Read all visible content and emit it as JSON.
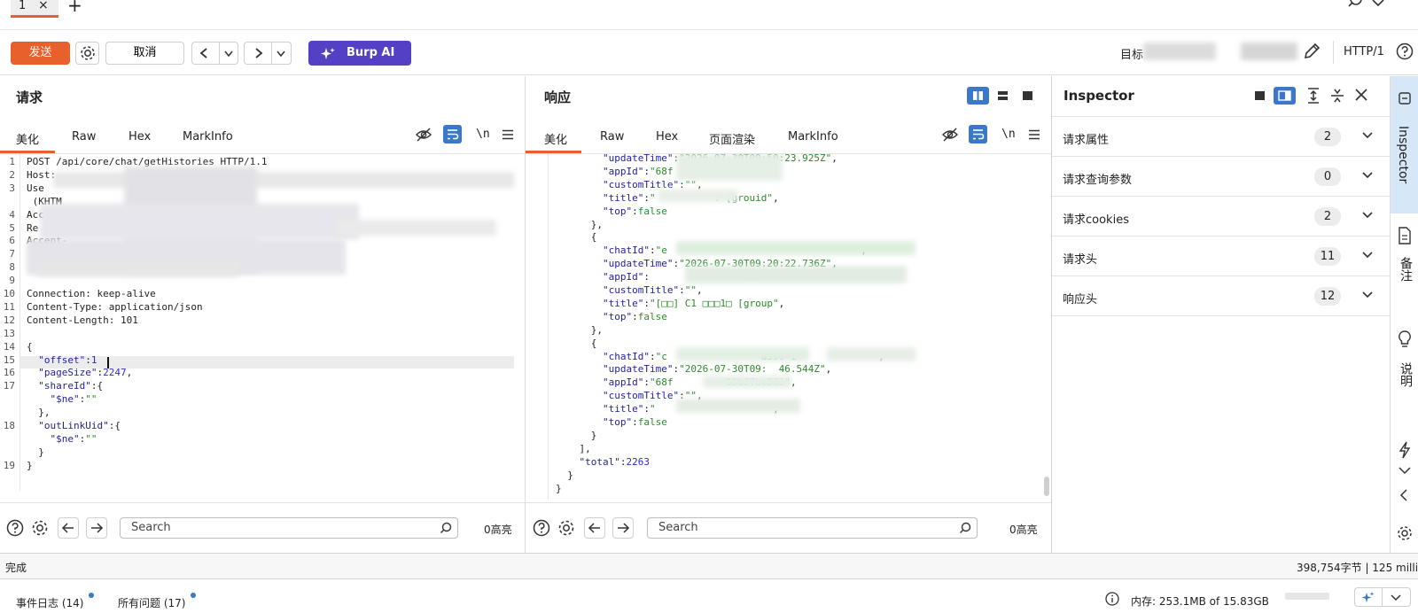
{
  "tabs": {
    "active_label": "1",
    "close_glyph": "×",
    "add_glyph": "+"
  },
  "toolbar": {
    "send": "发送",
    "cancel": "取消",
    "burp_ai": "Burp AI",
    "target_label": "目标",
    "http_version": "HTTP/1"
  },
  "request": {
    "title": "请求",
    "tabs": [
      "美化",
      "Raw",
      "Hex",
      "MarkInfo"
    ],
    "newline_toggle": "\\n",
    "lines": [
      {
        "n": "1",
        "parts": [
          [
            "t",
            "POST /api/core/chat/getHistories HTTP/1.1"
          ]
        ]
      },
      {
        "n": "2",
        "parts": [
          [
            "t",
            "Host: "
          ]
        ]
      },
      {
        "n": "3",
        "parts": [
          [
            "t",
            "Use"
          ]
        ]
      },
      {
        "n": "",
        "parts": [
          [
            "t",
            " (KHTM"
          ]
        ]
      },
      {
        "n": "4",
        "parts": [
          [
            "t",
            "Accept: appl"
          ]
        ]
      },
      {
        "n": "5",
        "parts": [
          [
            "t",
            "Re"
          ]
        ]
      },
      {
        "n": "6",
        "parts": [
          [
            "t",
            "Accept-"
          ]
        ]
      },
      {
        "n": "7",
        "parts": [
          [
            "t",
            ""
          ]
        ]
      },
      {
        "n": "8",
        "parts": [
          [
            "t",
            ""
          ]
        ]
      },
      {
        "n": "9",
        "parts": [
          [
            "t",
            ""
          ]
        ]
      },
      {
        "n": "10",
        "parts": [
          [
            "t",
            "Connection: keep-alive"
          ]
        ]
      },
      {
        "n": "11",
        "parts": [
          [
            "t",
            "Content-Type: application/json"
          ]
        ]
      },
      {
        "n": "12",
        "parts": [
          [
            "t",
            "Content-Length: 101"
          ]
        ]
      },
      {
        "n": "13",
        "parts": [
          [
            "t",
            ""
          ]
        ]
      },
      {
        "n": "14",
        "parts": [
          [
            "t",
            "{"
          ]
        ]
      },
      {
        "n": "15",
        "parts": [
          [
            "t",
            "  "
          ],
          [
            "k",
            "\"offset\""
          ],
          [
            "t",
            ":"
          ],
          [
            "n",
            "1"
          ]
        ]
      },
      {
        "n": "16",
        "parts": [
          [
            "t",
            "  "
          ],
          [
            "k",
            "\"pageSize\""
          ],
          [
            "t",
            ":"
          ],
          [
            "n",
            "2247"
          ],
          [
            "t",
            ","
          ]
        ]
      },
      {
        "n": "17",
        "parts": [
          [
            "t",
            "  "
          ],
          [
            "k",
            "\"shareId\""
          ],
          [
            "t",
            ":{"
          ]
        ]
      },
      {
        "n": "",
        "parts": [
          [
            "t",
            "    "
          ],
          [
            "k",
            "\"$ne\""
          ],
          [
            "t",
            ":"
          ],
          [
            "s",
            "\"\""
          ]
        ]
      },
      {
        "n": "",
        "parts": [
          [
            "t",
            "  },"
          ]
        ]
      },
      {
        "n": "18",
        "parts": [
          [
            "t",
            "  "
          ],
          [
            "k",
            "\"outLinkUid\""
          ],
          [
            "t",
            ":{"
          ]
        ]
      },
      {
        "n": "",
        "parts": [
          [
            "t",
            "    "
          ],
          [
            "k",
            "\"$ne\""
          ],
          [
            "t",
            ":"
          ],
          [
            "s",
            "\"\""
          ]
        ]
      },
      {
        "n": "",
        "parts": [
          [
            "t",
            "  }"
          ]
        ]
      },
      {
        "n": "19",
        "parts": [
          [
            "t",
            "}"
          ]
        ]
      }
    ],
    "search_placeholder": "Search",
    "highlights": "0高亮"
  },
  "response": {
    "title": "响应",
    "tabs": [
      "美化",
      "Raw",
      "Hex",
      "页面渲染",
      "MarkInfo"
    ],
    "newline_toggle": "\\n",
    "lines": [
      {
        "parts": [
          [
            "t",
            "        "
          ],
          [
            "k",
            "\"updateTime\""
          ],
          [
            "t",
            ":"
          ],
          [
            "s",
            "\"2026-07-30T09:50:23.925Z\""
          ],
          [
            "t",
            ","
          ]
        ]
      },
      {
        "parts": [
          [
            "t",
            "        "
          ],
          [
            "k",
            "\"appId\""
          ],
          [
            "t",
            ":"
          ],
          [
            "s",
            "\"68f"
          ],
          [
            "t",
            "          "
          ],
          [
            "s",
            "363\""
          ],
          [
            "t",
            ","
          ]
        ]
      },
      {
        "parts": [
          [
            "t",
            "        "
          ],
          [
            "k",
            "\"customTitle\""
          ],
          [
            "t",
            ":"
          ],
          [
            "s",
            "\"\""
          ],
          [
            "t",
            ","
          ]
        ]
      },
      {
        "parts": [
          [
            "t",
            "        "
          ],
          [
            "k",
            "\"title\""
          ],
          [
            "t",
            ":"
          ],
          [
            "s",
            "\"          ! [grou"
          ],
          [
            "s",
            "id\""
          ],
          [
            "t",
            ","
          ]
        ]
      },
      {
        "parts": [
          [
            "t",
            "        "
          ],
          [
            "k",
            "\"top\""
          ],
          [
            "t",
            ":"
          ],
          [
            "s",
            "false"
          ]
        ]
      },
      {
        "parts": [
          [
            "t",
            "      },"
          ]
        ]
      },
      {
        "parts": [
          [
            "t",
            "      {"
          ]
        ]
      },
      {
        "parts": [
          [
            "t",
            "        "
          ],
          [
            "k",
            "\"chatId\""
          ],
          [
            "t",
            ":"
          ],
          [
            "s",
            "\"e"
          ],
          [
            "t",
            "                                 "
          ],
          [
            "t",
            ","
          ]
        ]
      },
      {
        "parts": [
          [
            "t",
            "        "
          ],
          [
            "k",
            "\"updateTime\""
          ],
          [
            "t",
            ":"
          ],
          [
            "s",
            "\"2026-07-30T09:20:22.736Z\""
          ],
          [
            "t",
            ","
          ]
        ]
      },
      {
        "parts": [
          [
            "t",
            "        "
          ],
          [
            "k",
            "\"appId\""
          ],
          [
            "t",
            ":"
          ],
          [
            "t",
            "                "
          ],
          [
            "s",
            "7b"
          ]
        ]
      },
      {
        "parts": [
          [
            "t",
            "        "
          ],
          [
            "k",
            "\"customTitle\""
          ],
          [
            "t",
            ":"
          ],
          [
            "s",
            "\"\""
          ],
          [
            "t",
            ","
          ]
        ]
      },
      {
        "parts": [
          [
            "t",
            "        "
          ],
          [
            "k",
            "\"title\""
          ],
          [
            "t",
            ":"
          ],
          [
            "s",
            "\"[□□] C1 □□□1□ [group\""
          ],
          [
            "t",
            ","
          ]
        ]
      },
      {
        "parts": [
          [
            "t",
            "        "
          ],
          [
            "k",
            "\"top\""
          ],
          [
            "t",
            ":"
          ],
          [
            "s",
            "false"
          ]
        ]
      },
      {
        "parts": [
          [
            "t",
            "      },"
          ]
        ]
      },
      {
        "parts": [
          [
            "t",
            "      {"
          ]
        ]
      },
      {
        "parts": [
          [
            "t",
            "        "
          ],
          [
            "k",
            "\"chatId\""
          ],
          [
            "t",
            ":"
          ],
          [
            "s",
            "\"c"
          ],
          [
            "t",
            "               "
          ],
          [
            "s",
            "-a990-1"
          ],
          [
            "t",
            "             "
          ],
          [
            "t",
            "',"
          ]
        ]
      },
      {
        "parts": [
          [
            "t",
            "        "
          ],
          [
            "k",
            "\"updateTime\""
          ],
          [
            "t",
            ":"
          ],
          [
            "s",
            "\"2026-07-30T09:"
          ],
          [
            "t",
            "  "
          ],
          [
            "s",
            "46.544Z\""
          ],
          [
            "t",
            ","
          ]
        ]
      },
      {
        "parts": [
          [
            "t",
            "        "
          ],
          [
            "k",
            "\"appId\""
          ],
          [
            "t",
            ":"
          ],
          [
            "s",
            "\"68f"
          ],
          [
            "t",
            "         "
          ],
          [
            "s",
            "88b37bc363\""
          ],
          [
            "t",
            ","
          ]
        ]
      },
      {
        "parts": [
          [
            "t",
            "        "
          ],
          [
            "k",
            "\"customTitle\""
          ],
          [
            "t",
            ":"
          ],
          [
            "s",
            "\"\""
          ],
          [
            "t",
            ","
          ]
        ]
      },
      {
        "parts": [
          [
            "t",
            "        "
          ],
          [
            "k",
            "\"title\""
          ],
          [
            "t",
            ":"
          ],
          [
            "s",
            "\""
          ],
          [
            "t",
            "                   "
          ],
          [
            "s",
            "\""
          ],
          [
            "t",
            ","
          ]
        ]
      },
      {
        "parts": [
          [
            "t",
            "        "
          ],
          [
            "k",
            "\"top\""
          ],
          [
            "t",
            ":"
          ],
          [
            "s",
            "false"
          ]
        ]
      },
      {
        "parts": [
          [
            "t",
            "      }"
          ]
        ]
      },
      {
        "parts": [
          [
            "t",
            "    ],"
          ]
        ]
      },
      {
        "parts": [
          [
            "t",
            "    "
          ],
          [
            "k",
            "\"total\""
          ],
          [
            "t",
            ":"
          ],
          [
            "n",
            "2263"
          ]
        ]
      },
      {
        "parts": [
          [
            "t",
            "  }"
          ]
        ]
      },
      {
        "parts": [
          [
            "t",
            "}"
          ]
        ]
      }
    ],
    "search_placeholder": "Search",
    "highlights": "0高亮"
  },
  "inspector": {
    "title": "Inspector",
    "rows": [
      {
        "label": "请求属性",
        "count": "2"
      },
      {
        "label": "请求查询参数",
        "count": "0"
      },
      {
        "label": "请求cookies",
        "count": "2"
      },
      {
        "label": "请求头",
        "count": "11"
      },
      {
        "label": "响应头",
        "count": "12"
      }
    ]
  },
  "side_rail": {
    "inspector_label": "Inspector",
    "notes_label": "备注",
    "explain_label": "说明"
  },
  "status": {
    "left": "完成",
    "right": "398,754字节 | 125 millis"
  },
  "bottom": {
    "event_log": "事件日志 (14)",
    "all_issues": "所有问题 (17)",
    "memory": "内存: 253.1MB of 15.83GB"
  },
  "colors": {
    "accent": "#e8602c",
    "burp_ai": "#5340c4",
    "json_key": "#1f1f9c",
    "json_string": "#2a8a2a",
    "json_number": "#2a2acc",
    "toggle_active": "#3b78c7"
  },
  "icons": [
    "close-icon",
    "plus-icon",
    "search-icon",
    "gear-icon",
    "chevron-left-icon",
    "chevron-right-icon",
    "chevron-down-icon",
    "sparkle-icon",
    "pencil-icon",
    "help-icon",
    "eye-off-icon",
    "wrap-icon",
    "menu-icon",
    "arrow-left-icon",
    "arrow-right-icon",
    "layout-split-icon",
    "layout-rows-icon",
    "layout-single-icon",
    "collapse-icon",
    "expand-icon",
    "inspector-icon",
    "notes-icon",
    "lightbulb-icon",
    "lightning-icon",
    "info-icon"
  ]
}
